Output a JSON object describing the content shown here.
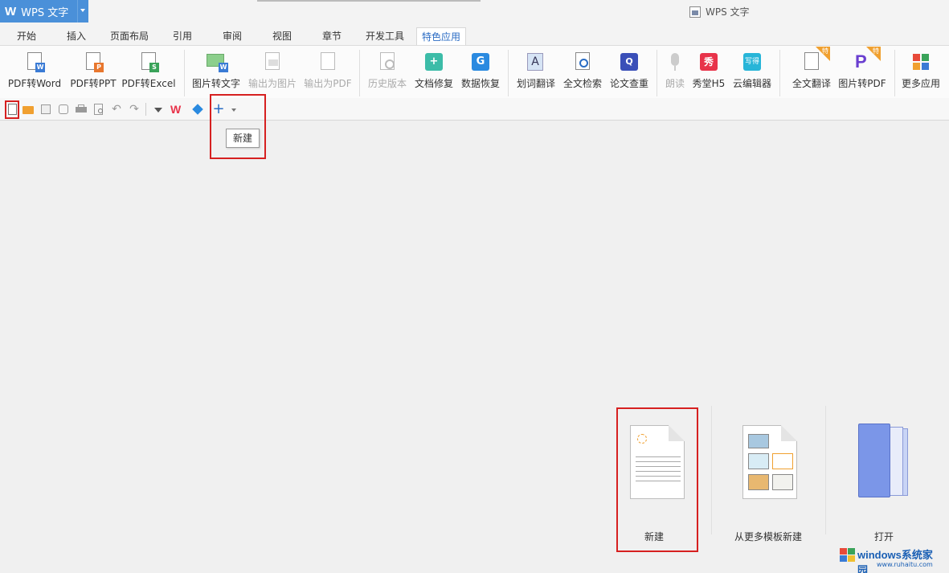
{
  "app": {
    "menu_button": "WPS 文字",
    "window_title": "WPS 文字"
  },
  "tabs": [
    {
      "label": "开始"
    },
    {
      "label": "插入"
    },
    {
      "label": "页面布局"
    },
    {
      "label": "引用"
    },
    {
      "label": "审阅"
    },
    {
      "label": "视图"
    },
    {
      "label": "章节"
    },
    {
      "label": "开发工具"
    },
    {
      "label": "特色应用",
      "active": true
    }
  ],
  "ribbon": {
    "buttons": [
      {
        "label": "PDF转Word",
        "icon": "pdf-to-word-icon",
        "enabled": true
      },
      {
        "label": "PDF转PPT",
        "icon": "pdf-to-ppt-icon",
        "enabled": true
      },
      {
        "label": "PDF转Excel",
        "icon": "pdf-to-excel-icon",
        "enabled": true
      },
      {
        "label": "图片转文字",
        "icon": "image-to-text-icon",
        "enabled": true
      },
      {
        "label": "输出为图片",
        "icon": "export-image-icon",
        "enabled": false
      },
      {
        "label": "输出为PDF",
        "icon": "export-pdf-icon",
        "enabled": false
      },
      {
        "label": "历史版本",
        "icon": "history-icon",
        "enabled": false
      },
      {
        "label": "文档修复",
        "icon": "doc-repair-icon",
        "enabled": true
      },
      {
        "label": "数据恢复",
        "icon": "data-recovery-icon",
        "enabled": true
      },
      {
        "label": "划词翻译",
        "icon": "translate-word-icon",
        "enabled": true
      },
      {
        "label": "全文检索",
        "icon": "fulltext-search-icon",
        "enabled": true
      },
      {
        "label": "论文查重",
        "icon": "paper-check-icon",
        "enabled": true
      },
      {
        "label": "朗读",
        "icon": "microphone-icon",
        "enabled": false
      },
      {
        "label": "秀堂H5",
        "icon": "xiutang-icon",
        "enabled": true,
        "glyph": "秀"
      },
      {
        "label": "云编辑器",
        "icon": "cloud-editor-icon",
        "enabled": true,
        "glyph": "写得"
      },
      {
        "label": "全文翻译",
        "icon": "full-translate-icon",
        "enabled": true,
        "special": "特"
      },
      {
        "label": "图片转PDF",
        "icon": "image-to-pdf-icon",
        "enabled": true,
        "special": "特"
      },
      {
        "label": "更多应用",
        "icon": "more-apps-icon",
        "enabled": true
      }
    ]
  },
  "tooltip": {
    "text": "新建"
  },
  "start": {
    "new": "新建",
    "from_template": "从更多模板新建",
    "open": "打开"
  },
  "watermark": {
    "brand": "windows系统家园",
    "url": "www.ruhaitu.com"
  },
  "colors": {
    "accent": "#4a90d9",
    "highlight": "#d62020",
    "active_tab_text": "#2b6cc4"
  }
}
